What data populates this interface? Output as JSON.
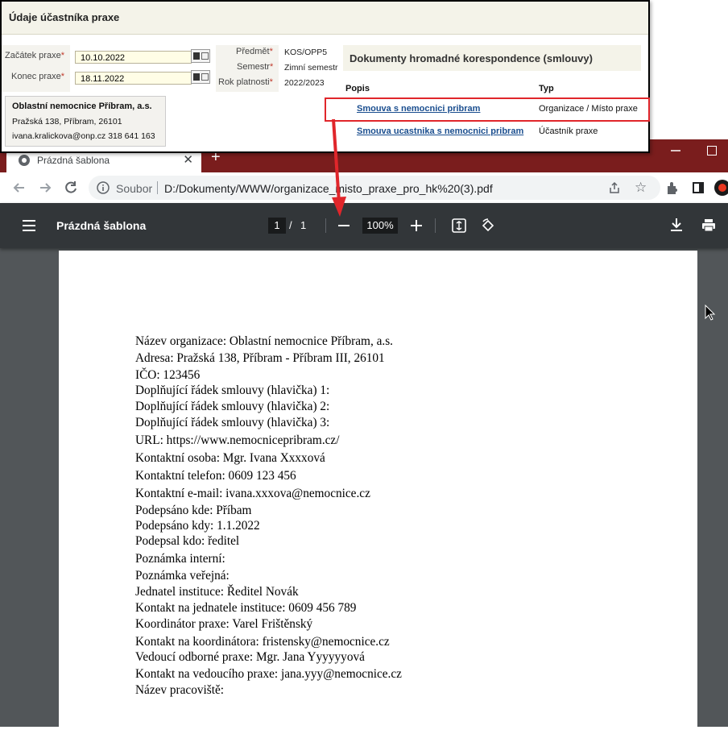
{
  "panel": {
    "title": "Údaje účastníka praxe",
    "fields": {
      "start_label": "Začátek praxe",
      "start_value": "10.10.2022",
      "end_label": "Konec praxe",
      "end_value": "18.11.2022",
      "subject_label": "Předmět",
      "subject_value": "KOS/OPP5",
      "semester_label": "Semestr",
      "semester_value": "Zimní semestr",
      "year_label": "Rok platnosti",
      "year_value": "2022/2023",
      "required_mark": "*"
    },
    "organization": {
      "name": "Oblastní nemocnice Příbram, a.s.",
      "address": "Pražská 138, Příbram, 26101",
      "contact": "ivana.kralickova@onp.cz 318 641 163"
    },
    "documents": {
      "title": "Dokumenty hromadné korespondence (smlouvy)",
      "col_description": "Popis",
      "col_type": "Typ",
      "rows": [
        {
          "name": "Smouva s nemocnici pribram",
          "type": "Organizace / Místo praxe"
        },
        {
          "name": "Smouva ucastnika s nemocnici pribram",
          "type": "Účastník praxe"
        }
      ]
    }
  },
  "browser": {
    "tab_title": "Prázdná šablona",
    "address_prefix": "Soubor",
    "url": "D:/Dokumenty/WWW/organizace_misto_praxe_pro_hk%20(3).pdf",
    "colors": {
      "titlebar": "#7a1d1d",
      "pdf_toolbar": "#323639",
      "pdf_background": "#525659"
    }
  },
  "pdf_viewer": {
    "title": "Prázdná šablona",
    "page_current": "1",
    "page_separator": "/",
    "page_total": "1",
    "zoom": "100%",
    "lines": [
      "Název organizace: Oblastní nemocnice Příbram, a.s.",
      "Adresa: Pražská 138, Příbram - Příbram III, 26101",
      "IČO: 123456",
      "Doplňující řádek smlouvy (hlavička) 1:",
      "Doplňující řádek smlouvy (hlavička) 2:",
      "Doplňující řádek smlouvy (hlavička) 3:",
      "URL: https://www.nemocnicepribram.cz/",
      "Kontaktní osoba: Mgr. Ivana Xxxxová",
      "Kontaktní telefon: 0609 123 456",
      "Kontaktní e-mail: ivana.xxxova@nemocnice.cz",
      "Podepsáno kde: Příbam",
      "Podepsáno kdy: 1.1.2022",
      "Podepsal kdo: ředitel",
      "Poznámka interní:",
      "Poznámka veřejná:",
      "Jednatel instituce: Ředitel Novák",
      "Kontakt na jednatele instituce: 0609 456 789",
      "Koordinátor praxe: Varel Frištěnský",
      "Kontakt na koordinátora: fristensky@nemocnice.cz",
      "Vedoucí odborné praxe: Mgr. Jana Yyyyyyová",
      "Kontakt na vedoucího praxe: jana.yyy@nemocnice.cz",
      "Název pracoviště:"
    ]
  },
  "icons": [
    "chrome-favicon",
    "close-icon",
    "new-tab-icon",
    "back-icon",
    "forward-icon",
    "reload-icon",
    "info-icon",
    "share-icon",
    "star-icon",
    "extensions-icon",
    "side-panel-icon",
    "profile-icon",
    "menu-icon",
    "zoom-out-icon",
    "zoom-in-icon",
    "fit-page-icon",
    "rotate-icon",
    "download-icon",
    "print-icon",
    "calendar-icon"
  ],
  "annotation": {
    "highlight_color": "#e0262b"
  }
}
